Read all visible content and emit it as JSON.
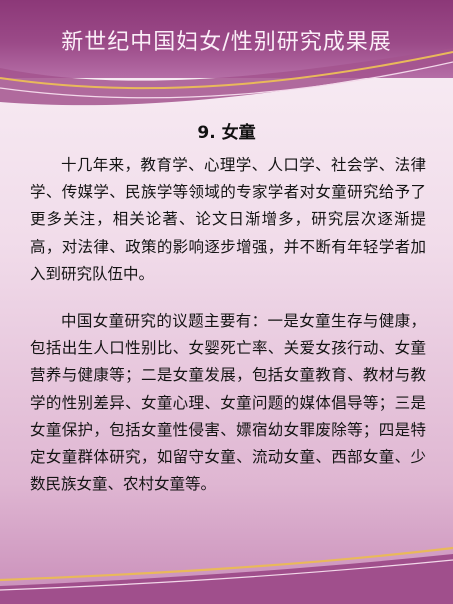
{
  "header": {
    "title": "新世纪中国妇女/性别研究成果展"
  },
  "section": {
    "title": "9. 女童",
    "paragraphs": [
      "十几年来，教育学、心理学、人口学、社会学、法律学、传媒学、民族学等领域的专家学者对女童研究给予了更多关注，相关论著、论文日渐增多，研究层次逐渐提高，对法律、政策的影响逐步增强，并不断有年轻学者加入到研究队伍中。",
      "中国女童研究的议题主要有：一是女童生存与健康，包括出生人口性别比、女婴死亡率、关爱女孩行动、女童营养与健康等；二是女童发展，包括女童教育、教材与教学的性别差异、女童心理、女童问题的媒体倡导等；三是女童保护，包括女童性侵害、嫖宿幼女罪废除等；四是特定女童群体研究，如留守女童、流动女童、西部女童、少数民族女童、农村女童等。"
    ]
  },
  "colors": {
    "header_bg": "#8c3878",
    "accent_gold": "#e9b95a",
    "page_bg": "#f3e2ee"
  }
}
